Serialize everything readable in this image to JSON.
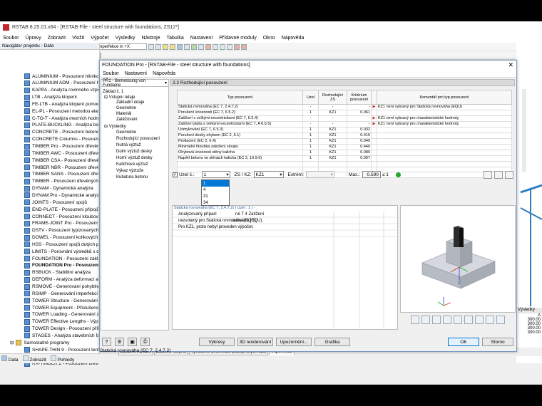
{
  "app": {
    "title": "RSTAB 8.25.01.x64 - [RSTAB-File - steel structure with foundations, ZS12*]",
    "menu": [
      "Soubor",
      "Úpravy",
      "Zobrazit",
      "Vložit",
      "Výpočet",
      "Výsledky",
      "Nástroje",
      "Tabulka",
      "Nastavení",
      "Přídavné moduly",
      "Okno",
      "Nápověda"
    ],
    "combo_lc": "ZS12 - Imperfekce in +X"
  },
  "navigator": {
    "title": "Navigátor projektu - Data",
    "items": [
      "ALUMINIUM - Posouzení hliníkov",
      "ALUMINIUM ADM - Posouzení hli",
      "KAPPA - Analýza rovinného vzpě",
      "LTB - Analýza klopení",
      "FE-LTB - Analýza klopení pomoc",
      "EL-PL - Posouzení metodou elast",
      "C-TO-T - Analýza mezních hodno",
      "PLATE-BUCKLING - Analýza boul",
      "CONCRETE - Posouzení betonový",
      "CONCRETE Columns - Posouzení",
      "TIMBER Pro - Posouzení dřevěný",
      "TIMBER AWC - Posouzení dřevěn",
      "TIMBER CSA - Posouzení dřevěn",
      "TIMBER NBR - Posouzení dřevěn",
      "TIMBER SANS - Posouzení dřeven",
      "TIMBER - Posouzení dřevěných p",
      "DYNAM - Dynamická analýza",
      "DYNAM Pro - Dynamické analýz",
      "JOINTS - Posouzení spojů",
      "END-PLATE - Posouzení přípojů",
      "CONNECT - Posouzení kloubový",
      "FRAME-JOINT Pro - Posouzení tu",
      "DSTV - Posouzení typizovaných p",
      "DOWEL - Posouzení kolíkových s",
      "HSS - Posouzení spojů dutých pr",
      "LIMITS - Porovnání výsledků s de",
      "FOUNDATION - Posouzení základ",
      "FOUNDATION Pro - Posouzení z",
      "RSBUCK - Stabilitní analýza",
      "DEFORM - Analýza deformací a p",
      "RSMOVE - Generování pohyblivý",
      "RSIMP - Generování imperfekcí",
      "TOWER Structure - Generování p",
      "TOWER Equipment - Příslušenství",
      "TOWER Loading - Generování zat",
      "TOWER Effective Lengths - Výpo",
      "TOWER Design - Posouzení příhr",
      "STAGES - Analýza stavebních faz"
    ],
    "group2": "Samostatné programy",
    "group2_items": [
      "SHAPE-THIN 9 - Posouzení tenko",
      "CRANEWAY 8 - Posouzení nosník",
      "RX-TIMBER 2 - Posouzení dřevěných k"
    ],
    "bottom": [
      "Data",
      "Zobrazit",
      "Pohledy"
    ]
  },
  "ws_tabs": [
    "Zatížení na uzel",
    "Zatížení na prut",
    "Vynucené deformace podepřených uzlů",
    "Imperfekce"
  ],
  "dialog": {
    "title": "FOUNDATION Pro - [RSTAB-File - steel structure with foundations]",
    "menu": [
      "Soubor",
      "Nastavení",
      "Nápověda"
    ],
    "case": "PŘ1 - Bemessung von Fundame",
    "tree": {
      "root": "Základ č. 1",
      "input": "Vstupní údaje",
      "input_items": [
        "Základní údaje",
        "Geometrie",
        "Materiál",
        "Zatěžování"
      ],
      "results": "Výsledky",
      "result_items": [
        "Geometrie",
        "Rozhodující posouzení",
        "Nutná výztuž",
        "Dolní výztuž desky",
        "Horní výztuž desky",
        "Kalichová výztuž",
        "Výkaz výztuže",
        "Kubatura betonu"
      ]
    },
    "header": "2.2 Rozhodující posouzení",
    "table": {
      "cols": [
        "Typ posouzení",
        "Uzel",
        "Rozhodující ZS",
        "Kritérium posouzení",
        "",
        "Komentář pro typ posouzení"
      ],
      "rows": [
        [
          "Statická rovnováha (EC 7, 2.4.7.2)",
          "-",
          "-",
          "-",
          "▶",
          "KZ1 není vybraný pro Statická rovnováha (EQU)"
        ],
        [
          "Porušení únosnosti (EC 7, 6.5.2)",
          "1",
          "KZ1",
          "0.061",
          "",
          ""
        ],
        [
          "Zatížení s velkými excentricitami (EC 7, 6.5.4)",
          "-",
          "-",
          "-",
          "▶",
          "KZ1 není vybraný pro charakteristické hodnoty"
        ],
        [
          "Zatížení jádra s velkými excentricitami (EC 7, A 6.6.5)",
          "-",
          "-",
          "-",
          "▶",
          "KZ1 není vybraný pro charakteristické hodnoty"
        ],
        [
          "Usmykování (EC 7, 6.5.3)",
          "1",
          "KZ1",
          "0.032",
          "",
          ""
        ],
        [
          "Porušení desky ohybem (EC 2, 6.1)",
          "1",
          "KZ1",
          "0.410",
          "",
          ""
        ],
        [
          "Protlačení (EC 2, 6.4)",
          "1",
          "KZ1",
          "0.049",
          "",
          ""
        ],
        [
          "Minimální hloubka založení sloupu",
          "1",
          "KZ1",
          "0.440",
          "",
          ""
        ],
        [
          "Ohybová únosnost stěny kalicha",
          "1",
          "KZ1",
          "0.080",
          "",
          ""
        ],
        [
          "Napětí betonu ve stěnách kalicha (EC 2, 10.9.6)",
          "1",
          "KZ1",
          "0.007",
          "",
          ""
        ]
      ]
    },
    "filter": {
      "node_label": "Uzel č.:",
      "node_value": "1",
      "zs_label": "ZS / KZ:",
      "zs_value": "KZ1",
      "extrem_label": "Extrém:",
      "max_label": "Max.:",
      "max_value": "0.590",
      "max_suffix": "≤ 1",
      "dropdown": [
        "1",
        "4",
        "31",
        "34"
      ]
    },
    "detail": {
      "head": "Statická rovnováha (EC 7, 2.4.7.2) | Uzel : 1 | -",
      "lines": [
        "Analyzovaný případ:",
        "nezvolený pro Statická rovnováha (EQU).",
        "Pro KZ1, proto nebyl proveden výpočet."
      ],
      "right_frag": "né T 4 Zatížení",
      "right_frag2": "vnováha (EQU)."
    },
    "buttons": {
      "report": "Výkresy",
      "render": "3D renderování",
      "notes": "Upozornění...",
      "graphics": "Grafika",
      "ok": "OK",
      "cancel": "Storno"
    },
    "status": "Statická rovnováha (EC 7, 2.4.7.2)"
  },
  "ws_right": {
    "head": "Výsledky",
    "values": [
      "300.00",
      "300.00",
      "300.00",
      "300.00"
    ],
    "label": "A"
  },
  "colors": {
    "accent": "#0078d7",
    "logo": "#c3272b",
    "foundation": "#aeb2ba"
  }
}
